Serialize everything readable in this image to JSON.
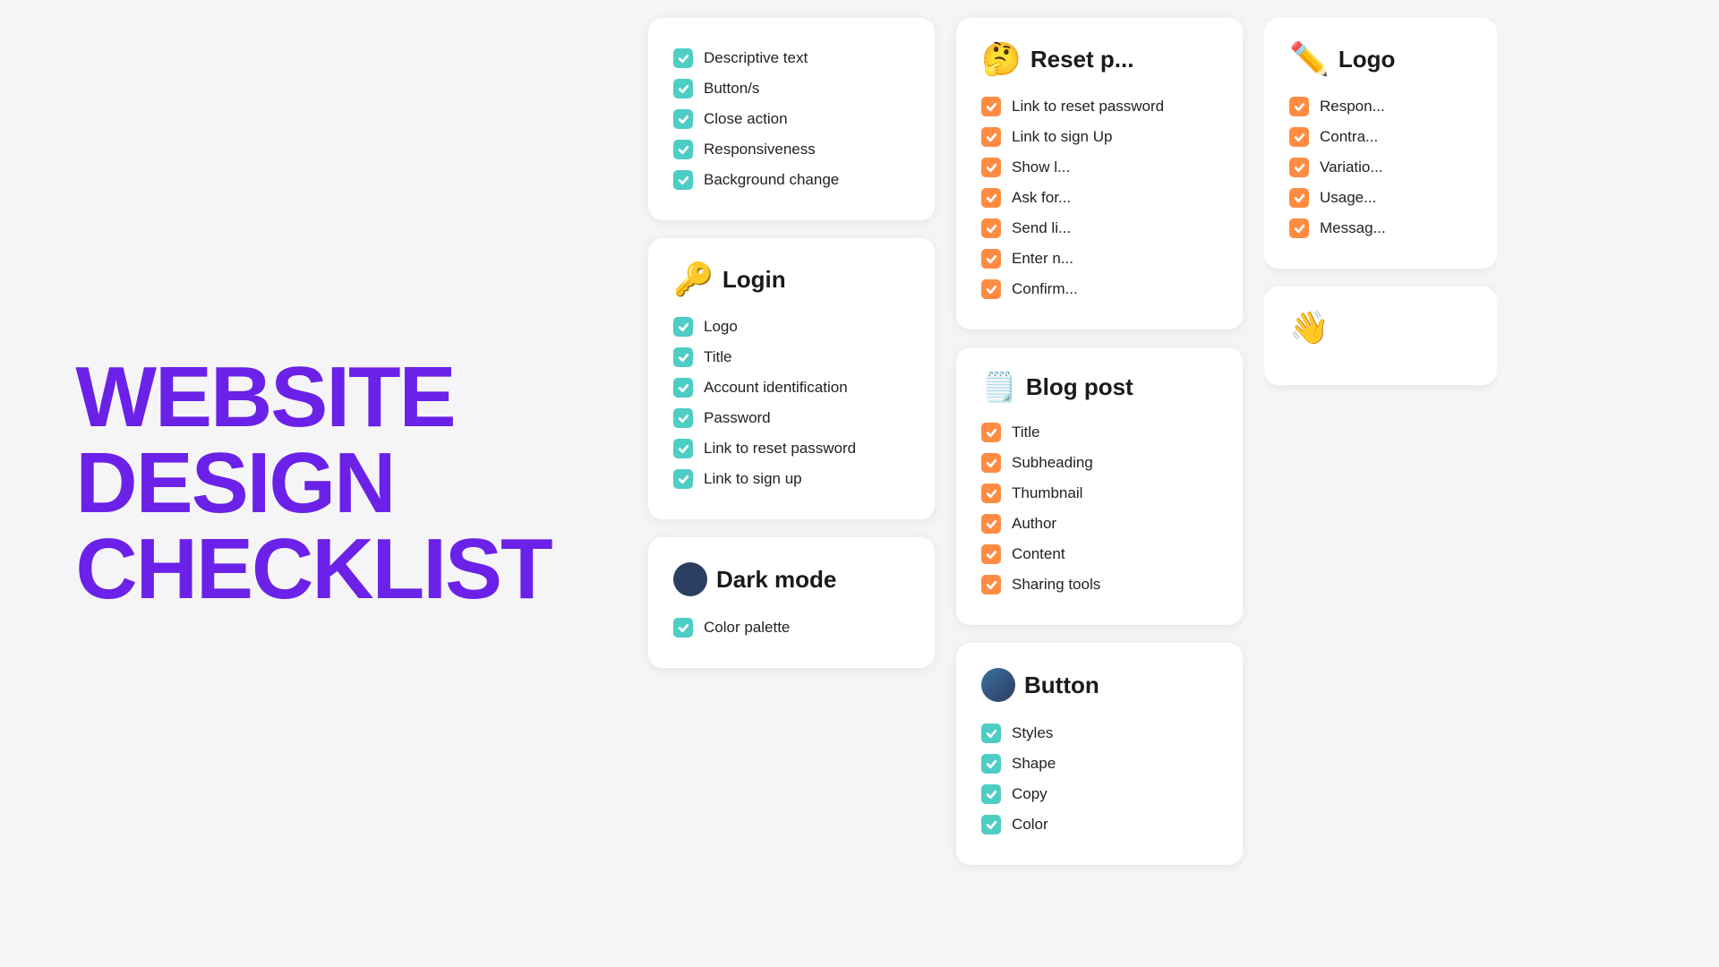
{
  "title": "WEBSITE\nDESIGN\nCHECKLIST",
  "cards": [
    {
      "id": "card-top-left-partial",
      "emoji": "",
      "title": "",
      "checkColor": "teal",
      "items": [
        "Descriptive text",
        "Button/s",
        "Close action",
        "Responsiveness",
        "Background change"
      ]
    },
    {
      "id": "card-login",
      "emoji": "🔑",
      "title": "Login",
      "checkColor": "teal",
      "items": [
        "Logo",
        "Title",
        "Account identification",
        "Password",
        "Link to reset password",
        "Link to sign up"
      ]
    },
    {
      "id": "card-dark-mode",
      "emoji": "🌑",
      "emojiType": "circle",
      "title": "Dark mode",
      "checkColor": "teal",
      "items": [
        "Color palette"
      ]
    }
  ],
  "right_cards": [
    {
      "id": "card-reset-password-partial",
      "emoji": "🤔",
      "title": "Reset p...",
      "checkColor": "orange",
      "items": [
        "Link to reset password",
        "Link to sign Up"
      ],
      "partialItems": [
        "Show l...",
        "Ask for...",
        "Send li...",
        "Enter n...",
        "Confirm..."
      ]
    },
    {
      "id": "card-blog-post",
      "emoji": "📝",
      "title": "Blog post",
      "checkColor": "orange",
      "items": [
        "Title",
        "Subheading",
        "Thumbnail",
        "Author",
        "Content",
        "Sharing tools"
      ]
    },
    {
      "id": "card-button",
      "emoji": "🌐",
      "emojiType": "globe",
      "title": "Button",
      "checkColor": "teal",
      "items": [
        "Styles",
        "Shape",
        "Copy",
        "Color"
      ]
    }
  ],
  "far_right_cards": [
    {
      "id": "card-logo-partial",
      "emoji": "✏️",
      "title": "Logo",
      "checkColor": "orange",
      "items": [
        "Respon...",
        "Contra...",
        "Variati...",
        "Usage...",
        "Messag..."
      ]
    },
    {
      "id": "card-hand-partial",
      "emoji": "👋",
      "title": "",
      "checkColor": "orange",
      "items": []
    }
  ],
  "colors": {
    "teal": "#4ecdc4",
    "orange": "#ff8c42",
    "blue": "#4a90d9",
    "purple": "#6B21E8",
    "background": "#f5f5f7",
    "card": "#ffffff"
  }
}
